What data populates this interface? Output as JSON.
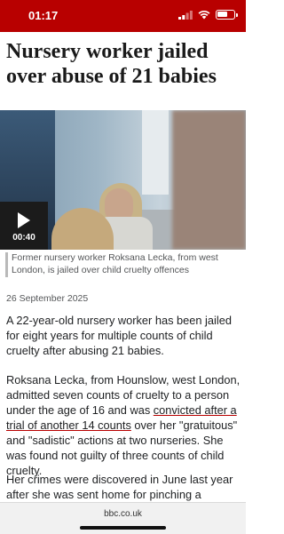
{
  "status_bar": {
    "time": "01:17"
  },
  "article": {
    "headline": "Nursery worker jailed over abuse of 21 babies",
    "media": {
      "duration": "00:40"
    },
    "caption": "Former nursery worker Roksana Lecka, from west London, is jailed over child cruelty offences",
    "date": "26 September 2025",
    "paragraph1": "A 22-year-old nursery worker has been jailed for eight years for multiple counts of child cruelty after abusing 21 babies.",
    "paragraph2_a": "Roksana Lecka, from Hounslow, west London, admitted seven counts of cruelty to a person under the age of 16 and was ",
    "paragraph2_link": "convicted after a trial of another 14 counts",
    "paragraph2_b": " over her \"gratuitous\" and \"sadistic\" actions at two nurseries. She was found not guilty of three counts of child cruelty.",
    "paragraph3": "Her crimes were discovered in June last year after she was sent home for pinching a number of"
  },
  "browser": {
    "url": "bbc.co.uk"
  }
}
